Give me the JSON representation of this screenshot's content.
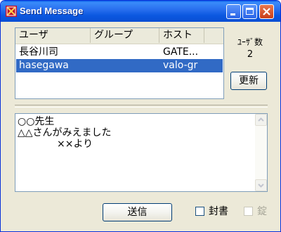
{
  "window": {
    "title": "Send Message"
  },
  "listview": {
    "columns": [
      "ユーザ",
      "グループ",
      "ホスト"
    ],
    "rows": [
      {
        "user": "長谷川司",
        "group": "",
        "host": "GATE..."
      },
      {
        "user": "hasegawa",
        "group": "",
        "host": "valo-gr"
      }
    ],
    "selected_row": 1
  },
  "user_count": {
    "label": "ﾕｰｻﾞ数",
    "value": "2"
  },
  "refresh_label": "更新",
  "message": {
    "lines": [
      "○○先生",
      "△△さんがみえました",
      "　　　　××より"
    ]
  },
  "send_label": "送信",
  "options": {
    "seal_label": "封書",
    "seal_checked": false,
    "lock_label": "錠",
    "lock_enabled": false
  },
  "colors": {
    "titlebar": "#0b58e0",
    "selection": "#316ac5",
    "face": "#ece9d8"
  }
}
